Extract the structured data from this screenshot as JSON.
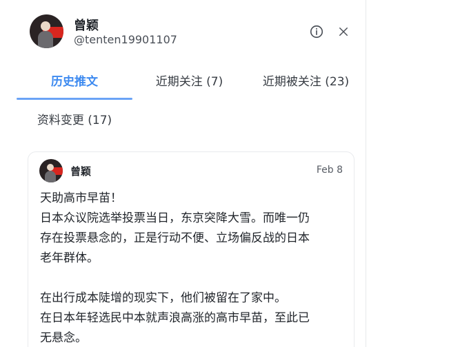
{
  "profile": {
    "name": "曾颖",
    "handle": "@tenten19901107",
    "info_icon": "info-circle-icon",
    "close_icon": "close-icon"
  },
  "tabs": [
    {
      "label": "历史推文",
      "active": true
    },
    {
      "label": "近期关注 (7)",
      "active": false
    },
    {
      "label": "近期被关注 (23)",
      "active": false
    },
    {
      "label": "资料变更 (17)",
      "active": false
    }
  ],
  "post": {
    "author": "曾颖",
    "date": "Feb 8",
    "lines": [
      "天助高市早苗！",
      "日本众议院选举投票当日，东京突降大雪。而唯一仍",
      "存在投票悬念的，正是行动不便、立场偏反战的日本",
      "老年群体。",
      "在出行成本陡增的现实下，他们被留在了家中。",
      "在日本年轻选民中本就声浪高涨的高市早苗，至此已",
      "无悬念。"
    ]
  },
  "colors": {
    "accent": "#3d8af0",
    "text": "#1f2329",
    "muted": "#575c64",
    "border": "#e8eaed"
  }
}
